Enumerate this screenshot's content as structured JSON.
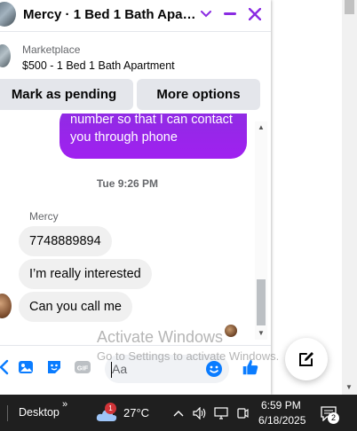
{
  "chat": {
    "title": "Mercy · 1 Bed 1 Bath Apart...",
    "listing": {
      "category": "Marketplace",
      "title": "$500 - 1 Bed 1 Bath Apartment"
    },
    "actions": {
      "mark_pending": "Mark as pending",
      "more_options": "More options"
    },
    "messages": {
      "outgoing_text": "number so that I can contact you through phone",
      "timestamp": "Tue 9:26 PM",
      "sender_name": "Mercy",
      "incoming": [
        "7748889894",
        "I’m really interested",
        "Can you call me"
      ]
    },
    "composer": {
      "placeholder": "Aa"
    },
    "accent_color": "#8e2de2"
  },
  "watermark": {
    "line1": "Activate Windows",
    "line2": "Go to Settings to activate Windows."
  },
  "taskbar": {
    "desktop_label": "Desktop",
    "chevron": "»",
    "weather_badge": "1",
    "temperature": "27°C",
    "time": "6:59 PM",
    "date": "6/18/2025",
    "notification_count": "2"
  }
}
